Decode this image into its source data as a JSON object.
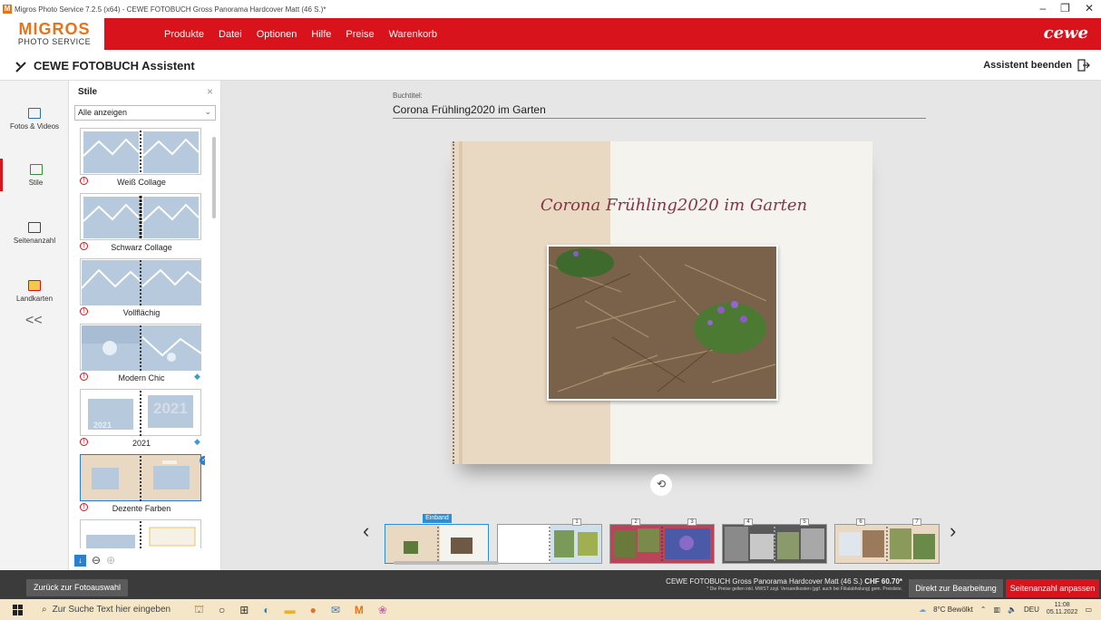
{
  "window": {
    "title": "Migros Photo Service 7.2.5 (x64) - CEWE FOTOBUCH Gross Panorama Hardcover Matt (46 S.)*",
    "controls": [
      "–",
      "❐",
      "✕"
    ]
  },
  "header": {
    "brand_top": "MIGROS",
    "brand_bottom": "PHOTO SERVICE",
    "menu": [
      "Produkte",
      "Datei",
      "Optionen",
      "Hilfe",
      "Preise",
      "Warenkorb"
    ],
    "cewe_logo": "cewe",
    "accent_color": "#d8131c"
  },
  "assistant": {
    "title": "CEWE FOTOBUCH Assistent",
    "exit_label": "Assistent beenden"
  },
  "leftnav": {
    "items": [
      {
        "label": "Fotos & Videos",
        "icon": "photos-icon"
      },
      {
        "label": "Stile",
        "icon": "styles-icon"
      },
      {
        "label": "Seitenanzahl",
        "icon": "page-count-icon"
      },
      {
        "label": "Landkarten",
        "icon": "map-pin-icon"
      }
    ],
    "collapse_glyph": "<<"
  },
  "styles_panel": {
    "heading": "Stile",
    "filter_value": "Alle anzeigen",
    "styles": [
      {
        "label": "Weiß Collage"
      },
      {
        "label": "Schwarz Collage"
      },
      {
        "label": "Vollflächig"
      },
      {
        "label": "Modern Chic"
      },
      {
        "label": "2021"
      },
      {
        "label": "Dezente Farben"
      }
    ]
  },
  "main": {
    "book_title_label": "Buchtitel:",
    "book_title_value": "Corona Frühling2020 im Garten",
    "cover_title": "Corona Frühling2020 im Garten",
    "einband_label": "Einband",
    "page_numbers": [
      "1",
      "2",
      "3",
      "4",
      "5",
      "6",
      "7"
    ]
  },
  "bottom": {
    "back_label": "Zurück zur Fotoauswahl",
    "product_line": "CEWE FOTOBUCH Gross Panorama Hardcover Matt (46 S.)",
    "price": "CHF 60.70*",
    "price_note": "* Die Preise gelten inkl. MWST zzgl. Versandkosten (ggf. auch bei Filialabholung) gem. Preisliste.",
    "direct_edit_label": "Direkt zur Bearbeitung",
    "adjust_pages_label": "Seitenanzahl anpassen"
  },
  "taskbar": {
    "search_placeholder": "Zur Suche Text hier eingeben",
    "weather": "8°C Bewölkt",
    "lang": "DEU",
    "time": "11:08",
    "date": "05.11.2022"
  }
}
